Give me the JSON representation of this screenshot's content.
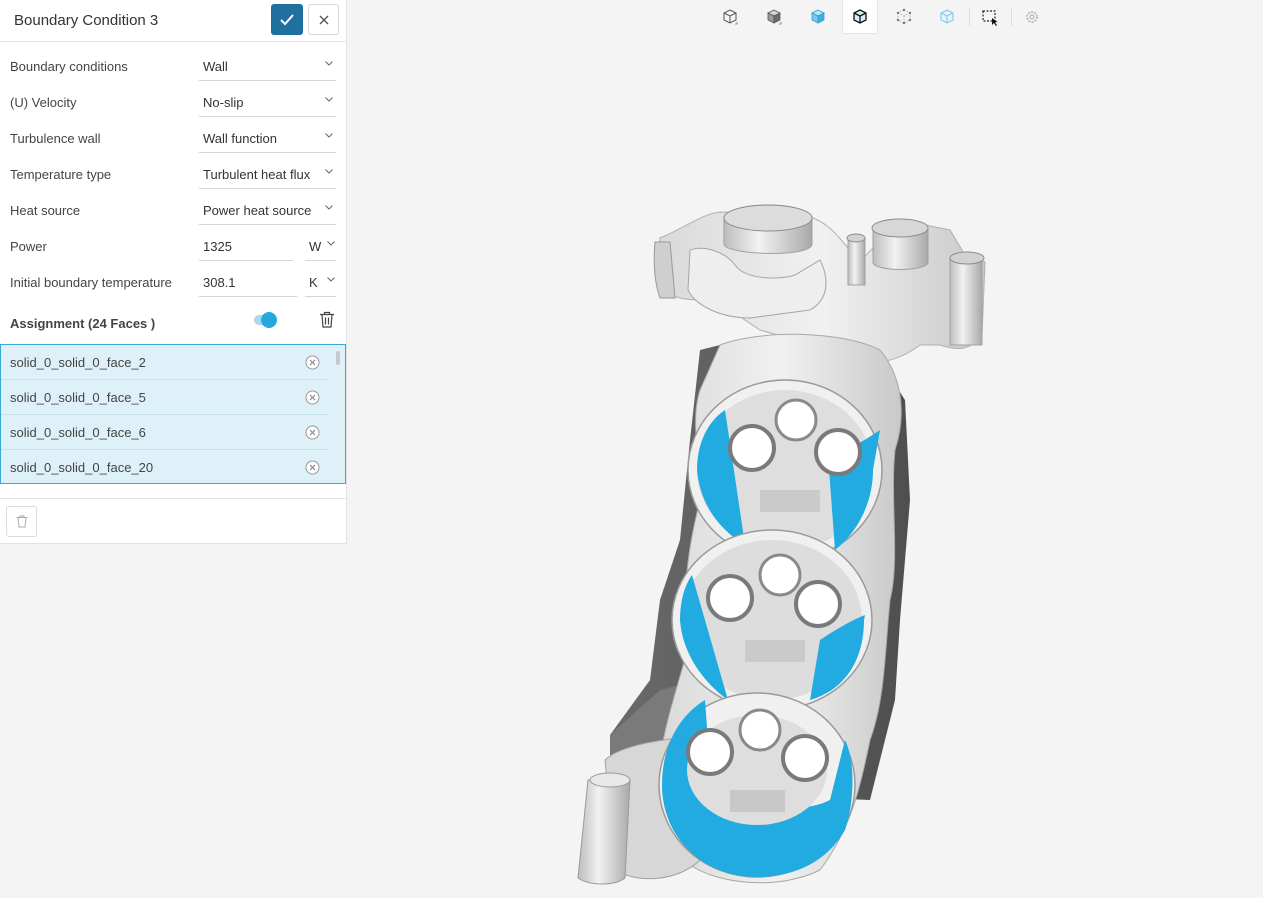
{
  "panel": {
    "title": "Boundary Condition 3",
    "confirm_icon": "check-icon",
    "close_icon": "close-icon"
  },
  "fields": {
    "boundary_conditions": {
      "label": "Boundary conditions",
      "value": "Wall"
    },
    "velocity": {
      "label": "(U) Velocity",
      "value": "No-slip"
    },
    "turbulence_wall": {
      "label": "Turbulence wall",
      "value": "Wall function"
    },
    "temperature_type": {
      "label": "Temperature type",
      "value": "Turbulent heat flux"
    },
    "heat_source": {
      "label": "Heat source",
      "value": "Power heat source"
    },
    "power": {
      "label": "Power",
      "value": "1325",
      "unit": "W"
    },
    "initial_temperature": {
      "label": "Initial boundary temperature",
      "value": "308.1",
      "unit": "K"
    }
  },
  "assignment": {
    "label": "Assignment (24 Faces )",
    "toggle_on": true,
    "faces": [
      "solid_0_solid_0_face_2",
      "solid_0_solid_0_face_5",
      "solid_0_solid_0_face_6",
      "solid_0_solid_0_face_20"
    ]
  },
  "toolbar": {
    "tools": [
      "cube-outline-icon",
      "cube-solid-icon",
      "cube-blue-icon",
      "cube-wire-active-icon",
      "cube-points-icon",
      "cube-transparent-icon",
      "box-select-icon",
      "settings-gear-icon"
    ]
  },
  "colors": {
    "accent": "#1f6f9f",
    "selection": "#22abe0",
    "list_bg": "#dff1f8",
    "model_light": "#dcdcdc",
    "model_dark": "#5f5f5f"
  }
}
